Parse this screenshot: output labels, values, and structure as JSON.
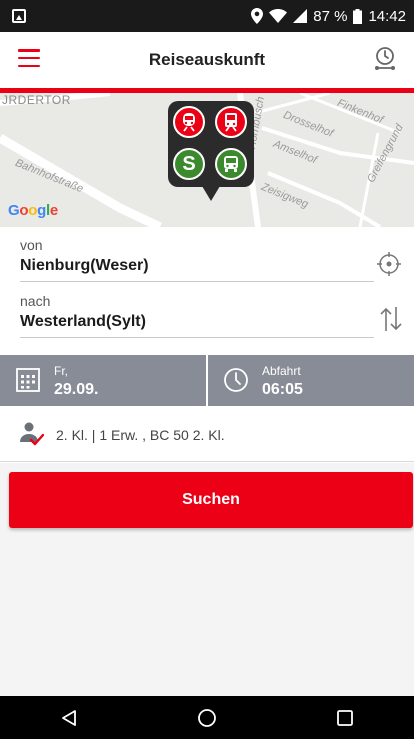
{
  "status_bar": {
    "battery": "87 %",
    "time": "14:42"
  },
  "header": {
    "title": "Reiseauskunft",
    "accent_color": "#ec0016"
  },
  "map": {
    "labels": {
      "tor": "JRDERTOR",
      "bahnhofstrasse": "Bahnhofstraße",
      "hornbusch": "Hornbusch",
      "drosselhof": "Drosselhof",
      "finkenhof": "Finkenhof",
      "amselhof": "Amselhof",
      "zeisigweg": "Zeisigweg",
      "greifengrund": "Greifengrund"
    },
    "attribution": "Google",
    "transit_icons": [
      "ice-train-icon",
      "regional-train-icon",
      "s-bahn-icon",
      "bus-icon"
    ]
  },
  "route": {
    "from_label": "von",
    "from_value": "Nienburg(Weser)",
    "to_label": "nach",
    "to_value": "Westerland(Sylt)"
  },
  "datetime": {
    "weekday": "Fr,",
    "date": "29.09.",
    "mode": "Abfahrt",
    "time": "06:05"
  },
  "passengers": {
    "summary": "2. Kl. | 1 Erw. , BC 50 2. Kl."
  },
  "search_button": {
    "label": "Suchen"
  }
}
